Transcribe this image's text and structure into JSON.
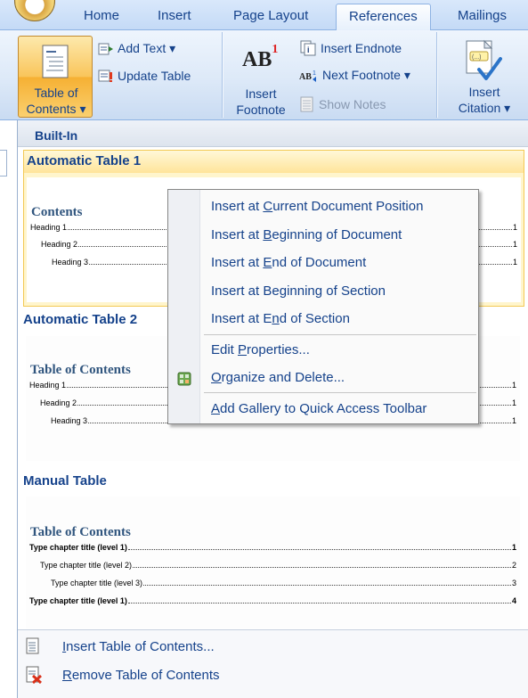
{
  "tabs": [
    "Home",
    "Insert",
    "Page Layout",
    "References",
    "Mailings"
  ],
  "active_tab": "References",
  "ribbon": {
    "toc_label_1": "Table of",
    "toc_label_2": "Contents ▾",
    "add_text": "Add Text ▾",
    "update_table": "Update Table",
    "insert_footnote_1": "Insert",
    "insert_footnote_2": "Footnote",
    "insert_endnote": "Insert Endnote",
    "next_footnote": "Next Footnote ▾",
    "show_notes": "Show Notes",
    "insert_citation_1": "Insert",
    "insert_citation_2": "Citation ▾",
    "ab_glyph": "AB",
    "ab_super": "1"
  },
  "menu": {
    "section_header": "Built-In",
    "galleries": [
      {
        "name": "Automatic Table 1",
        "preview_title": "Contents",
        "lines": [
          {
            "text": "Heading 1",
            "page": "1"
          },
          {
            "text": "Heading 2",
            "page": "1"
          },
          {
            "text": "Heading 3",
            "page": "1"
          }
        ]
      },
      {
        "name": "Automatic Table 2",
        "preview_title": "Table of Contents",
        "lines": [
          {
            "text": "Heading 1",
            "page": "1"
          },
          {
            "text": "Heading 2",
            "page": "1"
          },
          {
            "text": "Heading 3",
            "page": "1"
          }
        ]
      },
      {
        "name": "Manual Table",
        "preview_title": "Table of Contents",
        "lines": [
          {
            "text": "Type chapter title (level 1)",
            "page": "1"
          },
          {
            "text": "Type chapter title (level 2)",
            "page": "2"
          },
          {
            "text": "Type chapter title (level 3)",
            "page": "3"
          },
          {
            "text": "Type chapter title (level 1)",
            "page": "4"
          }
        ]
      }
    ],
    "insert_toc": {
      "pre": "",
      "u": "I",
      "post": "nsert Table of Contents..."
    },
    "remove_toc": {
      "pre": "",
      "u": "R",
      "post": "emove Table of Contents"
    }
  },
  "context_menu": {
    "items": [
      {
        "pre": "Insert at ",
        "u": "C",
        "post": "urrent Document Position"
      },
      {
        "pre": "Insert at ",
        "u": "B",
        "post": "eginning of Document"
      },
      {
        "pre": "Insert at ",
        "u": "E",
        "post": "nd of Document"
      },
      {
        "pre": "Insert at Be",
        "u": "g",
        "post": "inning of Section"
      },
      {
        "pre": "Insert at E",
        "u": "n",
        "post": "d of Section"
      },
      {
        "pre": "Edit ",
        "u": "P",
        "post": "roperties..."
      },
      {
        "pre": "",
        "u": "O",
        "post": "rganize and Delete..."
      },
      {
        "pre": "",
        "u": "A",
        "post": "dd Gallery to Quick Access Toolbar"
      }
    ]
  },
  "colors": {
    "accent": "#15428b",
    "highlight": "#fff5cc",
    "highlight_border": "#f3c954",
    "toc_button": "#f9c55b"
  },
  "icons": [
    "office-button-icon",
    "table-of-contents-icon",
    "add-text-icon",
    "update-table-icon",
    "insert-endnote-icon",
    "next-footnote-icon",
    "show-notes-icon",
    "insert-citation-icon",
    "organize-icon",
    "insert-toc-icon",
    "remove-toc-icon"
  ]
}
